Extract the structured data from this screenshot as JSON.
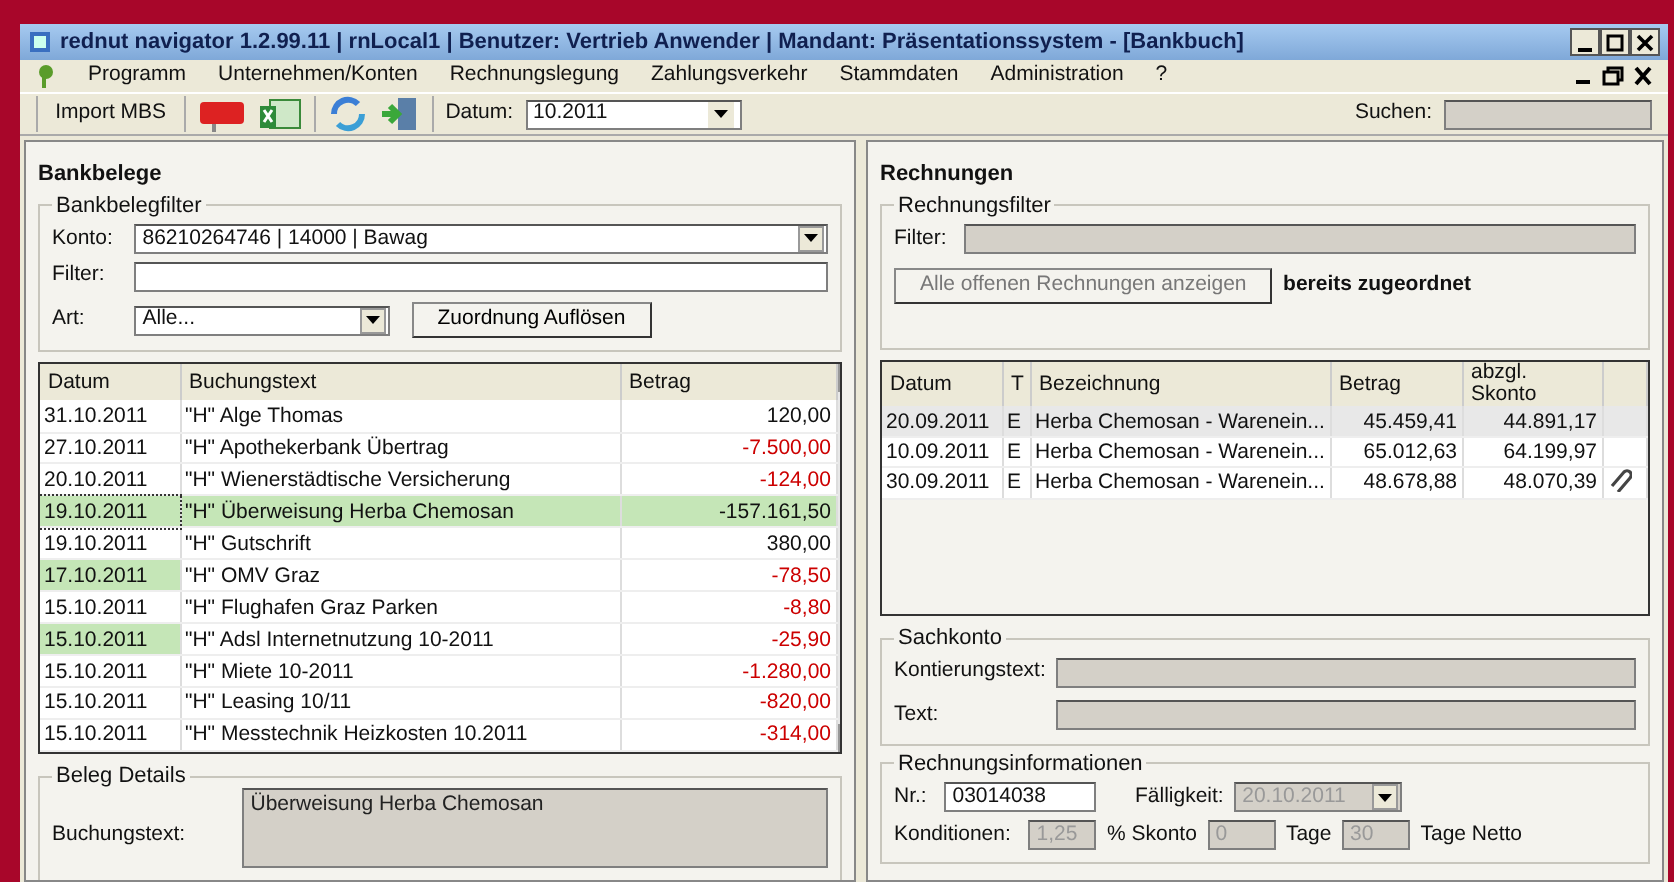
{
  "window": {
    "title": "rednut navigator 1.2.99.11  |  rnLocal1  |  Benutzer: Vertrieb Anwender  |  Mandant: Präsentationssystem - [Bankbuch]"
  },
  "menu": [
    "Programm",
    "Unternehmen/Konten",
    "Rechnungslegung",
    "Zahlungsverkehr",
    "Stammdaten",
    "Administration",
    "?"
  ],
  "toolbar": {
    "import_button": "Import MBS",
    "date_label": "Datum:",
    "date_value": "10.2011",
    "search_label": "Suchen:"
  },
  "bank": {
    "title": "Bankbelege",
    "filter": {
      "legend": "Bankbelegfilter",
      "konto_label": "Konto:",
      "konto_value": "86210264746 | 14000 | Bawag",
      "filter_label": "Filter:",
      "art_label": "Art:",
      "art_value": "Alle...",
      "button": "Zuordnung Auflösen"
    },
    "columns": [
      "Datum",
      "Buchungstext",
      "Betrag"
    ],
    "rows": [
      {
        "date": "31.10.2011",
        "text": "\"H\" Alge Thomas",
        "amount": "120,00",
        "negative": false,
        "selected": false,
        "marked": false
      },
      {
        "date": "27.10.2011",
        "text": "\"H\" Apothekerbank Übertrag",
        "amount": "-7.500,00",
        "negative": true,
        "selected": false,
        "marked": false
      },
      {
        "date": "20.10.2011",
        "text": "\"H\" Wienerstädtische Versicherung",
        "amount": "-124,00",
        "negative": true,
        "selected": false,
        "marked": false
      },
      {
        "date": "19.10.2011",
        "text": "\"H\" Überweisung Herba Chemosan",
        "amount": "-157.161,50",
        "negative": true,
        "selected": true,
        "marked": true
      },
      {
        "date": "19.10.2011",
        "text": "\"H\" Gutschrift",
        "amount": "380,00",
        "negative": false,
        "selected": false,
        "marked": false
      },
      {
        "date": "17.10.2011",
        "text": "\"H\" OMV Graz",
        "amount": "-78,50",
        "negative": true,
        "selected": false,
        "marked": true
      },
      {
        "date": "15.10.2011",
        "text": "\"H\" Flughafen Graz Parken",
        "amount": "-8,80",
        "negative": true,
        "selected": false,
        "marked": false
      },
      {
        "date": "15.10.2011",
        "text": "\"H\" Adsl Internetnutzung 10-2011",
        "amount": "-25,90",
        "negative": true,
        "selected": false,
        "marked": true
      },
      {
        "date": "15.10.2011",
        "text": "\"H\" Miete 10-2011",
        "amount": "-1.280,00",
        "negative": true,
        "selected": false,
        "marked": false
      },
      {
        "date": "15.10.2011",
        "text": "\"H\" Leasing 10/11",
        "amount": "-820,00",
        "negative": true,
        "selected": false,
        "marked": false
      },
      {
        "date": "15.10.2011",
        "text": "\"H\" Messtechnik Heizkosten 10.2011",
        "amount": "-314,00",
        "negative": true,
        "selected": false,
        "marked": false
      }
    ],
    "details": {
      "legend": "Beleg Details",
      "label": "Buchungstext:",
      "value": "Überweisung Herba Chemosan"
    }
  },
  "invoices": {
    "title": "Rechnungen",
    "filter": {
      "legend": "Rechnungsfilter",
      "filter_label": "Filter:",
      "button": "Alle offenen Rechnungen anzeigen",
      "status": "bereits zugeordnet"
    },
    "columns": [
      "Datum",
      "T",
      "Bezeichnung",
      "Betrag",
      "abzgl. Skonto"
    ],
    "rows": [
      {
        "date": "20.09.2011",
        "type": "E",
        "name": "Herba Chemosan - Warenein...",
        "amount": "45.459,41",
        "net": "44.891,17",
        "selected": true,
        "attachment": false
      },
      {
        "date": "10.09.2011",
        "type": "E",
        "name": "Herba Chemosan - Warenein...",
        "amount": "65.012,63",
        "net": "64.199,97",
        "selected": false,
        "attachment": false
      },
      {
        "date": "30.09.2011",
        "type": "E",
        "name": "Herba Chemosan - Warenein...",
        "amount": "48.678,88",
        "net": "48.070,39",
        "selected": false,
        "attachment": true
      }
    ],
    "sachkonto": {
      "legend": "Sachkonto",
      "kontierung_label": "Kontierungstext:",
      "text_label": "Text:"
    },
    "info": {
      "legend": "Rechnungsinformationen",
      "nr_label": "Nr.:",
      "nr_value": "03014038",
      "due_label": "Fälligkeit:",
      "due_value": "20.10.2011",
      "due_disabled": true,
      "cond_label": "Konditionen:",
      "skonto_value": "1,25",
      "skonto_label": "% Skonto",
      "days_value": "0",
      "days_label": "Tage",
      "net_days_value": "30",
      "net_days_label": "Tage Netto"
    }
  }
}
